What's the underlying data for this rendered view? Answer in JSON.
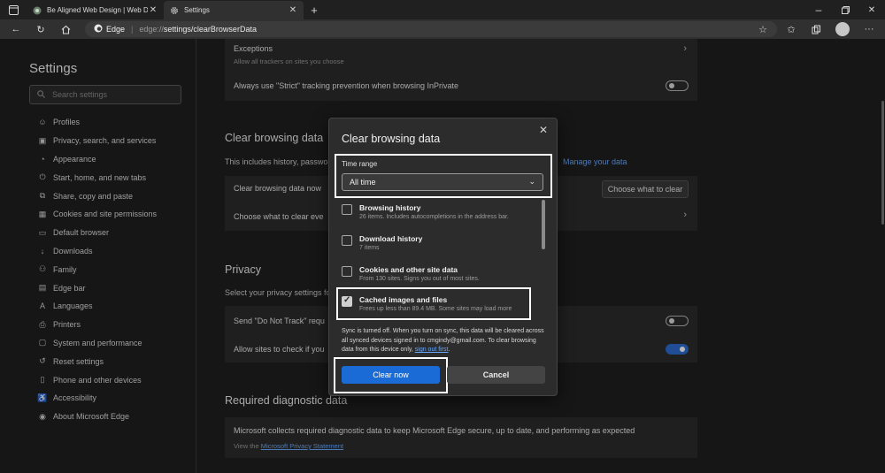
{
  "browser": {
    "tabs": [
      {
        "label": "Be Aligned Web Design | Web D",
        "active": false
      },
      {
        "label": "Settings",
        "active": true
      }
    ],
    "address": {
      "brand": "Edge",
      "scheme": "edge://",
      "path": "settings/clearBrowserData"
    }
  },
  "sidebar": {
    "title": "Settings",
    "search_placeholder": "Search settings",
    "items": [
      {
        "label": "Profiles",
        "icon": "person-icon"
      },
      {
        "label": "Privacy, search, and services",
        "icon": "lock-icon"
      },
      {
        "label": "Appearance",
        "icon": "palette-icon"
      },
      {
        "label": "Start, home, and new tabs",
        "icon": "power-icon"
      },
      {
        "label": "Share, copy and paste",
        "icon": "share-icon"
      },
      {
        "label": "Cookies and site permissions",
        "icon": "grid-icon"
      },
      {
        "label": "Default browser",
        "icon": "browser-icon"
      },
      {
        "label": "Downloads",
        "icon": "download-icon"
      },
      {
        "label": "Family",
        "icon": "family-icon"
      },
      {
        "label": "Edge bar",
        "icon": "edge-bar-icon"
      },
      {
        "label": "Languages",
        "icon": "languages-icon"
      },
      {
        "label": "Printers",
        "icon": "printer-icon"
      },
      {
        "label": "System and performance",
        "icon": "computer-icon"
      },
      {
        "label": "Reset settings",
        "icon": "reset-icon"
      },
      {
        "label": "Phone and other devices",
        "icon": "phone-icon"
      },
      {
        "label": "Accessibility",
        "icon": "accessibility-icon"
      },
      {
        "label": "About Microsoft Edge",
        "icon": "edge-logo-icon"
      }
    ]
  },
  "main": {
    "exceptions": {
      "title": "Exceptions",
      "sub": "Allow all trackers on sites you choose"
    },
    "strict_inprivate": {
      "label": "Always use \"Strict\" tracking prevention when browsing InPrivate",
      "on": false
    },
    "clear_heading": "Clear browsing data",
    "clear_desc": "This includes history, passwo",
    "manage_link": "Manage your data",
    "clear_now_label": "Clear browsing data now",
    "choose_button": "Choose what to clear",
    "choose_every_label": "Choose what to clear eve",
    "privacy_heading": "Privacy",
    "privacy_desc": "Select your privacy settings fo",
    "dnt_label": "Send \"Do Not Track\" requ",
    "dnt_on": false,
    "allow_check_label": "Allow sites to check if you",
    "allow_check_on": true,
    "diag_heading": "Required diagnostic data",
    "diag_text": "Microsoft collects required diagnostic data to keep Microsoft Edge secure, up to date, and performing as expected",
    "diag_view": "View the",
    "diag_link": "Microsoft Privacy Statement"
  },
  "dialog": {
    "title": "Clear browsing data",
    "time_range_label": "Time range",
    "time_range_value": "All time",
    "options": [
      {
        "title": "Browsing history",
        "sub": "26 items. Includes autocompletions in the address bar.",
        "checked": false
      },
      {
        "title": "Download history",
        "sub": "7 items",
        "checked": false
      },
      {
        "title": "Cookies and other site data",
        "sub": "From 130 sites. Signs you out of most sites.",
        "checked": false
      },
      {
        "title": "Cached images and files",
        "sub": "Frees up less than 89.4 MB. Some sites may load more",
        "checked": true
      }
    ],
    "sync_note": "Sync is turned off. When you turn on sync, this data will be cleared across all synced devices signed in to cmgindy@gmail.com. To clear browsing data from this device only,",
    "sync_link": "sign out first",
    "sync_end": ".",
    "clear_button": "Clear now",
    "cancel_button": "Cancel"
  },
  "colors": {
    "accent": "#1a6bd6",
    "highlight": "#ffffff",
    "background": "#1f1f1f"
  }
}
